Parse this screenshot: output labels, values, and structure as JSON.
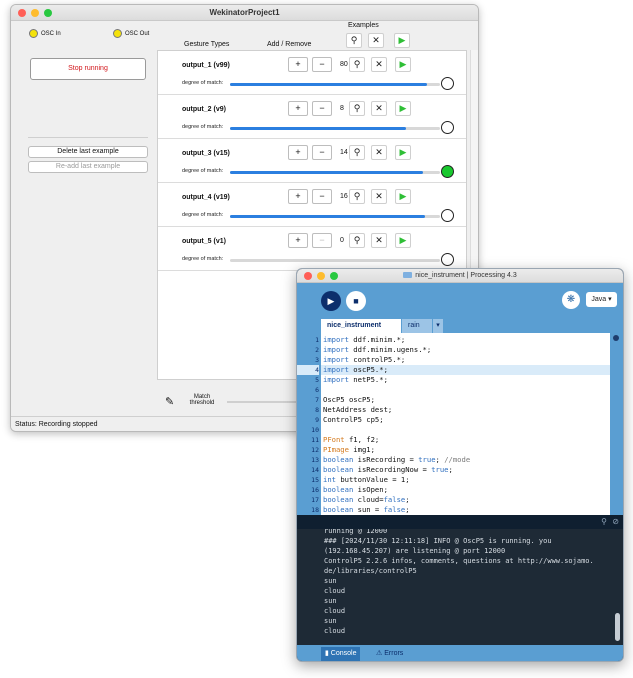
{
  "wekinator": {
    "title": "WekinatorProject1",
    "osc_in": "OSC In",
    "osc_out": "OSC Out",
    "stop_running": "Stop running",
    "delete_last": "Delete last example",
    "readd_last": "Re-add last example",
    "hdr_examples": "Examples",
    "hdr_gesture_types": "Gesture Types",
    "hdr_add_remove": "Add / Remove",
    "degree_label": "degree of match:",
    "match_threshold_line1": "Match",
    "match_threshold_line2": "threshold",
    "status": "Status:  Recording stopped",
    "outputs": [
      {
        "name": "output_1 (v99)",
        "count": "80",
        "match": 0.94,
        "active": false,
        "minus_enabled": true
      },
      {
        "name": "output_2 (v9)",
        "count": "8",
        "match": 0.84,
        "active": false,
        "minus_enabled": true
      },
      {
        "name": "output_3 (v15)",
        "count": "14",
        "match": 0.92,
        "active": true,
        "minus_enabled": true
      },
      {
        "name": "output_4 (v19)",
        "count": "16",
        "match": 0.93,
        "active": false,
        "minus_enabled": true
      },
      {
        "name": "output_5 (v1)",
        "count": "0",
        "match": 0.0,
        "active": false,
        "minus_enabled": false
      }
    ]
  },
  "processing": {
    "title": "nice_instrument | Processing 4.3",
    "mode": "Java ▾",
    "tab_active": "nice_instrument",
    "tab_other": "rain",
    "tab_arrow": "▾",
    "code": [
      {
        "n": "1",
        "t": "import ddf.minim.*;"
      },
      {
        "n": "2",
        "t": "import ddf.minim.ugens.*;"
      },
      {
        "n": "3",
        "t": "import controlP5.*;"
      },
      {
        "n": "4",
        "t": "import oscP5.*;"
      },
      {
        "n": "5",
        "t": "import netP5.*;"
      },
      {
        "n": "6",
        "t": ""
      },
      {
        "n": "7",
        "t": "OscP5 oscP5;"
      },
      {
        "n": "8",
        "t": "NetAddress dest;"
      },
      {
        "n": "9",
        "t": "ControlP5 cp5;"
      },
      {
        "n": "10",
        "t": ""
      },
      {
        "n": "11",
        "t": "PFont f1, f2;"
      },
      {
        "n": "12",
        "t": "PImage img1;"
      },
      {
        "n": "13",
        "t": "boolean isRecording = true; //mode"
      },
      {
        "n": "14",
        "t": "boolean isRecordingNow = true;"
      },
      {
        "n": "15",
        "t": "int buttonValue = 1;"
      },
      {
        "n": "16",
        "t": "boolean isOpen;"
      },
      {
        "n": "17",
        "t": "boolean cloud=false;"
      },
      {
        "n": "18",
        "t": "boolean sun = false;"
      }
    ],
    "highlight_line": "4",
    "console": [
      "running @ 12000",
      "### [2024/11/30 12:11:18] INFO @ OscP5 is running. you",
      "(192.168.45.207) are listening @ port 12000",
      "ControlP5 2.2.6 infos, comments, questions at http://www.sojamo.",
      "de/libraries/controlP5",
      "sun",
      "cloud",
      "sun",
      "cloud",
      "sun",
      "cloud"
    ],
    "footer_console": "Console",
    "footer_errors": "Errors"
  }
}
